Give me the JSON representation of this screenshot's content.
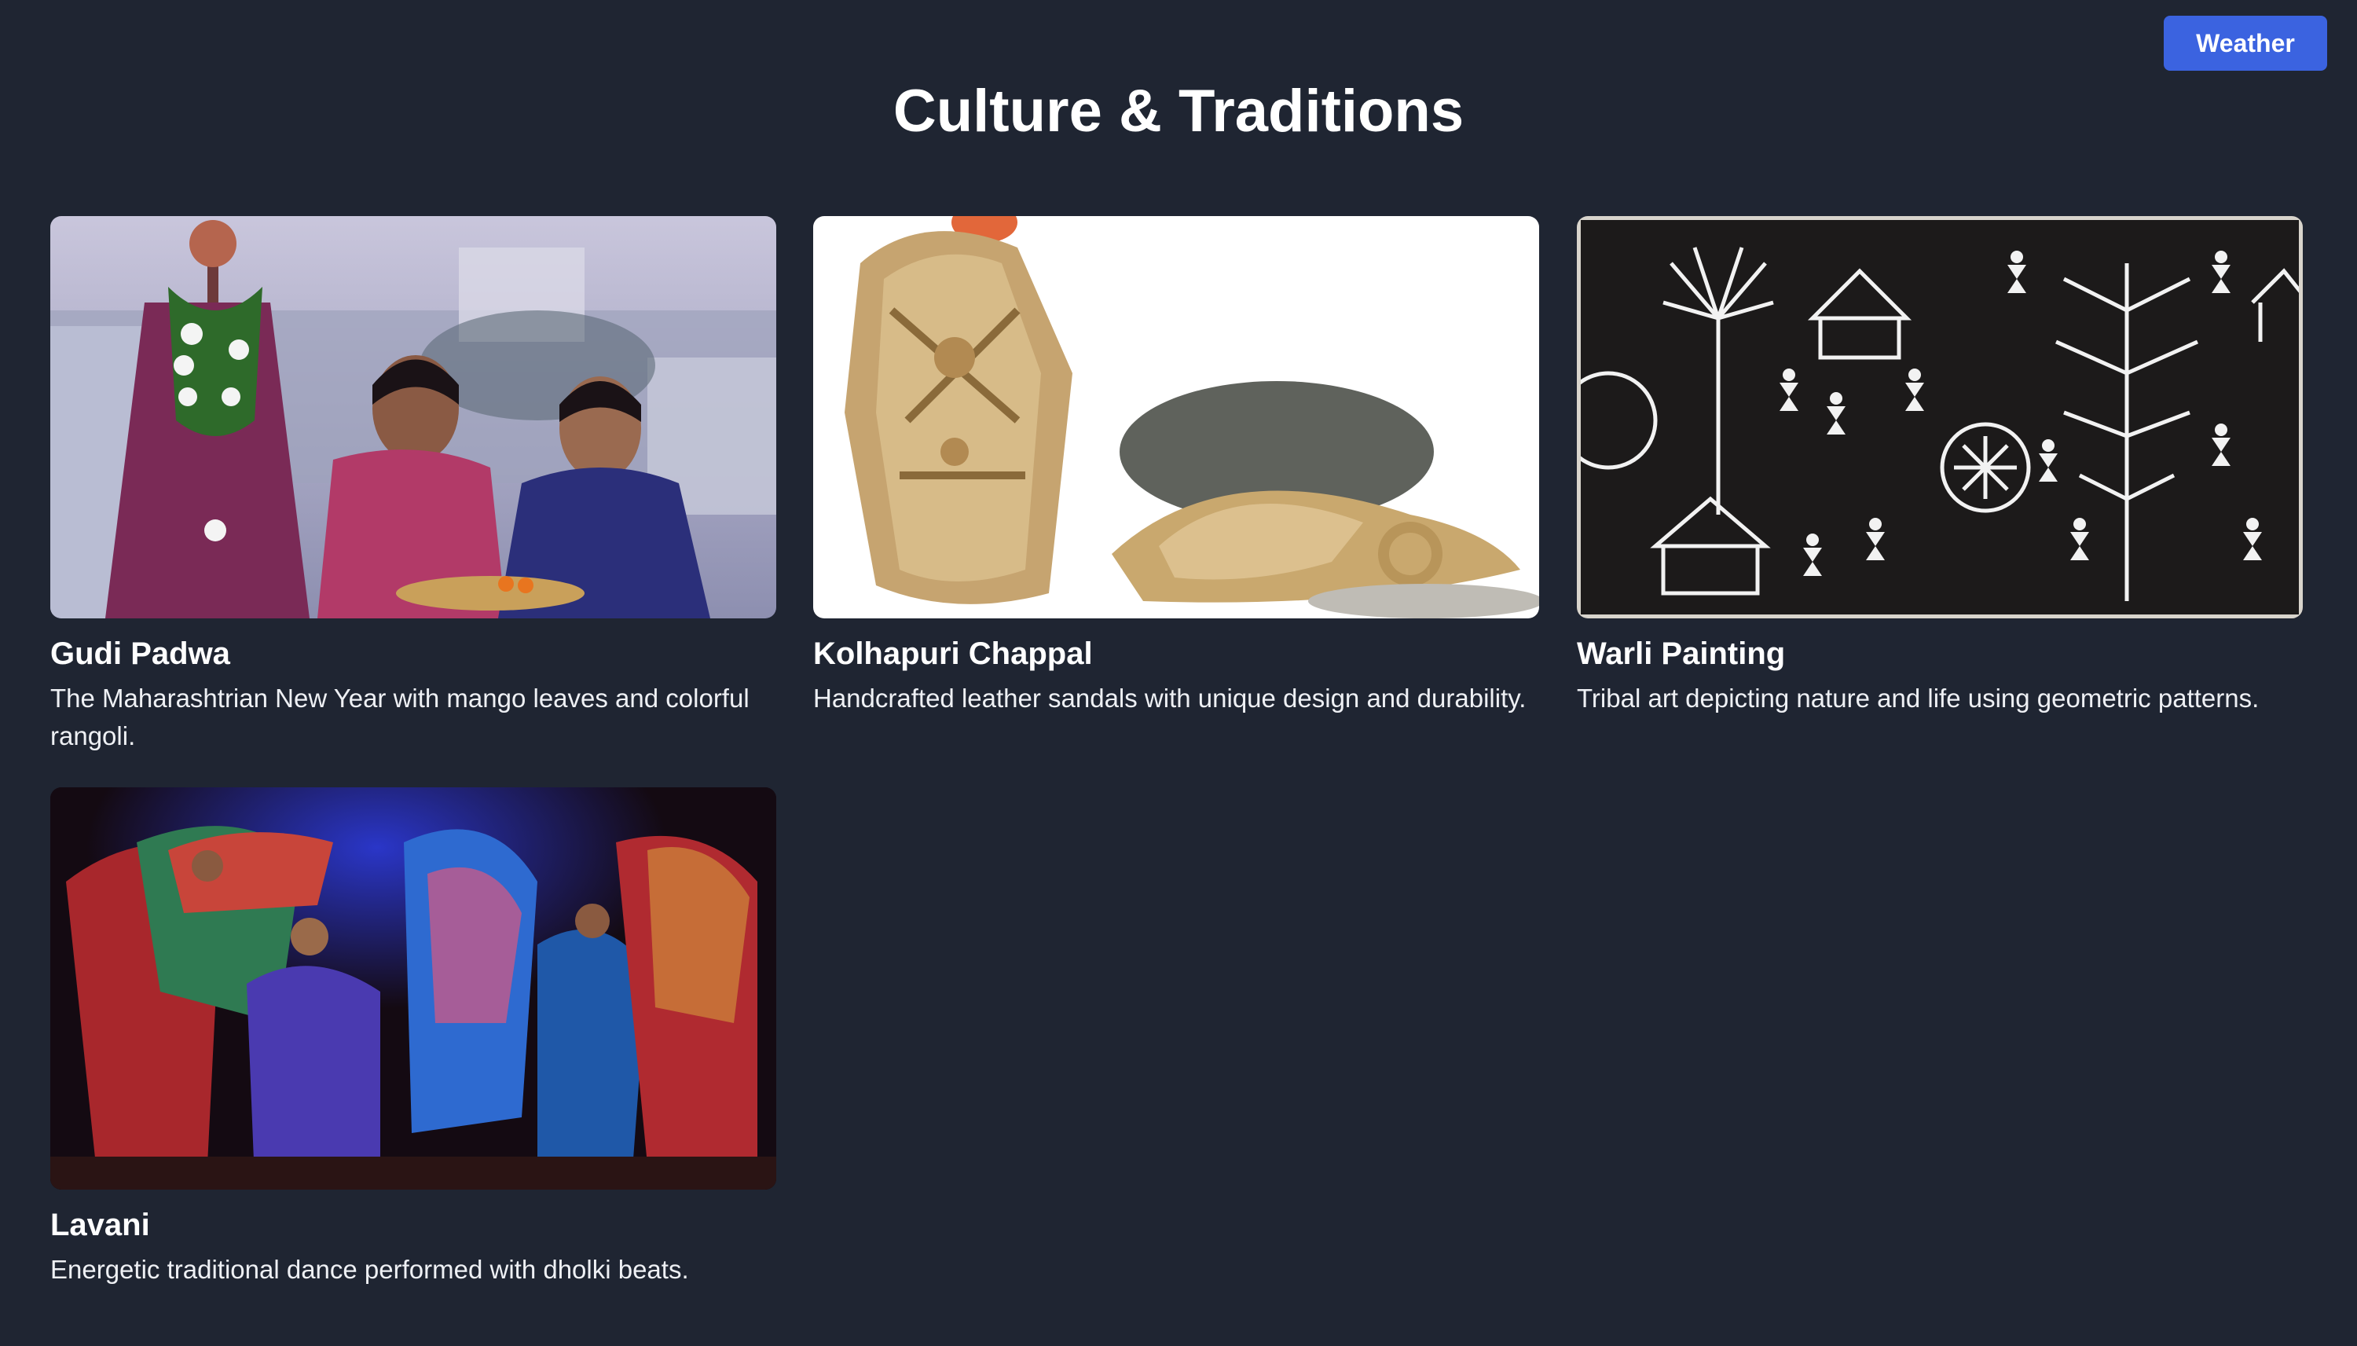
{
  "header": {
    "weather_button": "Weather",
    "title": "Culture & Traditions"
  },
  "cards": [
    {
      "title": "Gudi Padwa",
      "description": "The Maharashtrian New Year with mango leaves and colorful rangoli."
    },
    {
      "title": "Kolhapuri Chappal",
      "description": "Handcrafted leather sandals with unique design and durability."
    },
    {
      "title": "Warli Painting",
      "description": "Tribal art depicting nature and life using geometric patterns."
    },
    {
      "title": "Lavani",
      "description": "Energetic traditional dance performed with dholki beats."
    }
  ],
  "colors": {
    "background": "#1f2532",
    "accent": "#3b63e0"
  }
}
